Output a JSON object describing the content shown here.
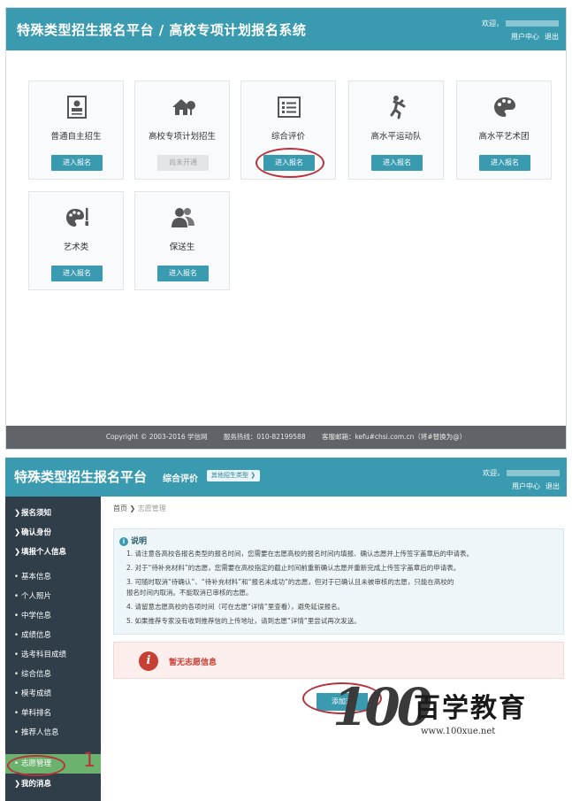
{
  "screen1": {
    "title": "特殊类型招生报名平台 / 高校专项计划报名系统",
    "user": {
      "welcome": "欢迎，",
      "center": "用户中心",
      "logout": "退出"
    },
    "tiles": [
      {
        "label": "普通自主招生",
        "button": "进入报名",
        "icon": "id-card-icon"
      },
      {
        "label": "高校专项计划招生",
        "button": "尚未开通",
        "icon": "house-tree-icon"
      },
      {
        "label": "综合评价",
        "button": "进入报名",
        "icon": "checklist-icon"
      },
      {
        "label": "高水平运动队",
        "button": "进入报名",
        "icon": "athlete-icon"
      },
      {
        "label": "高水平艺术团",
        "button": "进入报名",
        "icon": "palette-icon"
      },
      {
        "label": "艺术类",
        "button": "进入报名",
        "icon": "palette-brush-icon"
      },
      {
        "label": "保送生",
        "button": "进入报名",
        "icon": "people-icon"
      }
    ],
    "footer": {
      "copyright": "Copyright © 2003-2016 学信网",
      "hotline": "服务热线：010-82199588",
      "email": "客服邮箱：kefu#chsi.com.cn（将#替换为@）"
    }
  },
  "screen2": {
    "title": "特殊类型招生报名平台",
    "subtitle": "综合评价",
    "switch_label": "其他招生类型 ❯",
    "user": {
      "welcome": "欢迎，",
      "center": "用户中心",
      "logout": "退出"
    },
    "sidebar": [
      {
        "label": "报名须知",
        "type": "section"
      },
      {
        "label": "确认身份",
        "type": "section"
      },
      {
        "label": "填报个人信息",
        "type": "section"
      },
      {
        "label": "基本信息",
        "type": "item"
      },
      {
        "label": "个人照片",
        "type": "item"
      },
      {
        "label": "中学信息",
        "type": "item"
      },
      {
        "label": "成绩信息",
        "type": "item"
      },
      {
        "label": "选考科目成绩",
        "type": "item"
      },
      {
        "label": "综合信息",
        "type": "item"
      },
      {
        "label": "模考成绩",
        "type": "item"
      },
      {
        "label": "单科排名",
        "type": "item"
      },
      {
        "label": "推荐人信息",
        "type": "item"
      },
      {
        "label": "志愿管理",
        "type": "active"
      },
      {
        "label": "我的消息",
        "type": "section"
      }
    ],
    "breadcrumb": {
      "home": "首页",
      "sep": "❯",
      "current": "志愿管理"
    },
    "notice": {
      "heading": "说明",
      "lines": [
        "1. 请注意各高校各报名类型的报名时间，您需要在志愿高校的报名时间内填报、确认志愿并上传签字盖章后的申请表。",
        "2. 对于“待补充材料”的志愿，您需要在高校指定的截止时间前重新确认志愿并重新完成上传签字盖章后的申请表。",
        "3. 可随时取消“待确认”、“待补充材料”和“报名未成功”的志愿，但对于已确认且未被审核的志愿，只能在高校的",
        "报名时间内取消。不能取消已审核的志愿。",
        "4. 请留意志愿高校的各项时间（可在志愿“详情”里查看），避免延误报名。",
        "5. 如果推荐专家没有收到推荐信的上传地址，请到志愿“详情”里尝试再次发送。"
      ]
    },
    "empty_message": "暂无志愿信息",
    "add_button": "添加志",
    "annotation_number": "1",
    "watermark": {
      "digits": "100",
      "name": "百学教育",
      "url": "www.100xue.net"
    }
  },
  "colors": {
    "brand": "#3a9bb0",
    "sidebar": "#2f3e49",
    "active": "#6bb26f",
    "alert": "#c63e34",
    "annotation": "#b7323a"
  }
}
